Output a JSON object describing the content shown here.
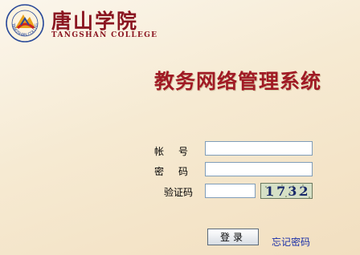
{
  "header": {
    "college_name": "唐山学院",
    "college_name_en": "TANGSHAN COLLEGE",
    "emblem_text": "TANGSHAN COLLEGE"
  },
  "main": {
    "title": "教务网络管理系统"
  },
  "form": {
    "account_label": "帐号",
    "account_value": "",
    "password_label": "密码",
    "password_value": "",
    "captcha_label": "验证码",
    "captcha_value": "",
    "captcha_code": "1732",
    "login_button": "登录",
    "forgot_password": "忘记密码"
  },
  "colors": {
    "title_red": "#a01a24",
    "brand_red": "#8a1520",
    "link_blue": "#1a2fa8"
  }
}
